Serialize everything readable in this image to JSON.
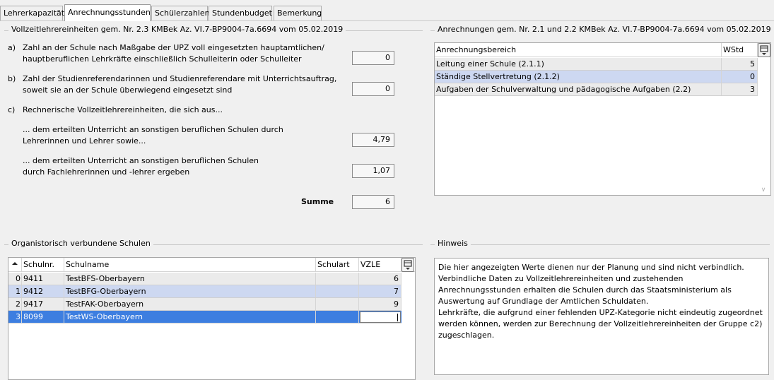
{
  "tabs": [
    {
      "label": "Lehrerkapazität",
      "active": false
    },
    {
      "label": "Anrechnungsstunden",
      "active": true
    },
    {
      "label": "Schülerzahlen",
      "active": false
    },
    {
      "label": "Stundenbudget",
      "active": false
    },
    {
      "label": "Bemerkung",
      "active": false
    }
  ],
  "vzle": {
    "title": "Vollzeitlehrereinheiten gem. Nr. 2.3 KMBek Az. VI.7-BP9004-7a.6694 vom 05.02.2019",
    "a_letter": "a)",
    "a_line1": "Zahl an der Schule nach Maßgabe der UPZ voll eingesetzten hauptamtlichen/",
    "a_line2": "hauptberuflichen Lehrkräfte einschließlich Schulleiterin oder Schulleiter",
    "a_value": "0",
    "b_letter": "b)",
    "b_line1": "Zahl der Studienreferendarinnen und Studienreferendare mit Unterrichtsauftrag,",
    "b_line2": "soweit sie an der Schule überwiegend eingesetzt sind",
    "b_value": "0",
    "c_letter": "c)",
    "c_line1": "Rechnerische Vollzeitlehrereinheiten, die sich aus...",
    "c1_line1": "... dem erteilten Unterricht an sonstigen beruflichen Schulen durch",
    "c1_line2": "Lehrerinnen und Lehrer sowie...",
    "c1_value": "4,79",
    "c2_line1": "... dem erteilten Unterricht an sonstigen beruflichen Schulen",
    "c2_line2": "durch Fachlehrerinnen und -lehrer ergeben",
    "c2_value": "1,07",
    "sum_label": "Summe",
    "sum_value": "6"
  },
  "anrechnungen": {
    "title": "Anrechnungen gem. Nr. 2.1 und 2.2 KMBek Az. VI.7-BP9004-7a.6694 vom 05.02.2019",
    "col_area": "Anrechnungsbereich",
    "col_wstd": "WStd",
    "rows": [
      {
        "area": "Leitung einer Schule (2.1.1)",
        "wstd": "5"
      },
      {
        "area": "Ständige Stellvertretung (2.1.2)",
        "wstd": "0"
      },
      {
        "area": "Aufgaben der Schulverwaltung und pädagogische Aufgaben (2.2)",
        "wstd": "3"
      }
    ]
  },
  "schools": {
    "title": "Organistorisch verbundene Schulen",
    "col_nr": "Schulnr.",
    "col_name": "Schulname",
    "col_art": "Schulart",
    "col_vzle": "VZLE",
    "rows": [
      {
        "idx": "0",
        "nr": "9411",
        "name": "TestBFS-Oberbayern",
        "art": "",
        "vzle": "6"
      },
      {
        "idx": "1",
        "nr": "9412",
        "name": "TestBFG-Oberbayern",
        "art": "",
        "vzle": "7"
      },
      {
        "idx": "2",
        "nr": "9417",
        "name": "TestFAK-Oberbayern",
        "art": "",
        "vzle": "9"
      },
      {
        "idx": "3",
        "nr": "8099",
        "name": "TestWS-Oberbayern",
        "art": "",
        "vzle": ""
      }
    ]
  },
  "hint": {
    "title": "Hinweis",
    "lines": [
      "Die hier angezeigten Werte dienen nur der Planung und sind nicht verbindlich.",
      "Verbindliche Daten zu Vollzeitlehrereinheiten und zustehenden",
      "Anrechnungsstunden erhalten die Schulen durch das Staatsministerium als",
      "Auswertung auf Grundlage der Amtlichen Schuldaten.",
      "Lehrkräfte, die aufgrund einer fehlenden UPZ-Kategorie nicht eindeutig zugeordnet",
      "werden können, werden zur Berechnung der Vollzeitlehrereinheiten der Gruppe c2)",
      "zugeschlagen."
    ]
  },
  "icons": {
    "sort_asc": "sort-ascending-icon",
    "table_menu": "table-menu-icon",
    "scroll_down": "scroll-down-icon"
  }
}
